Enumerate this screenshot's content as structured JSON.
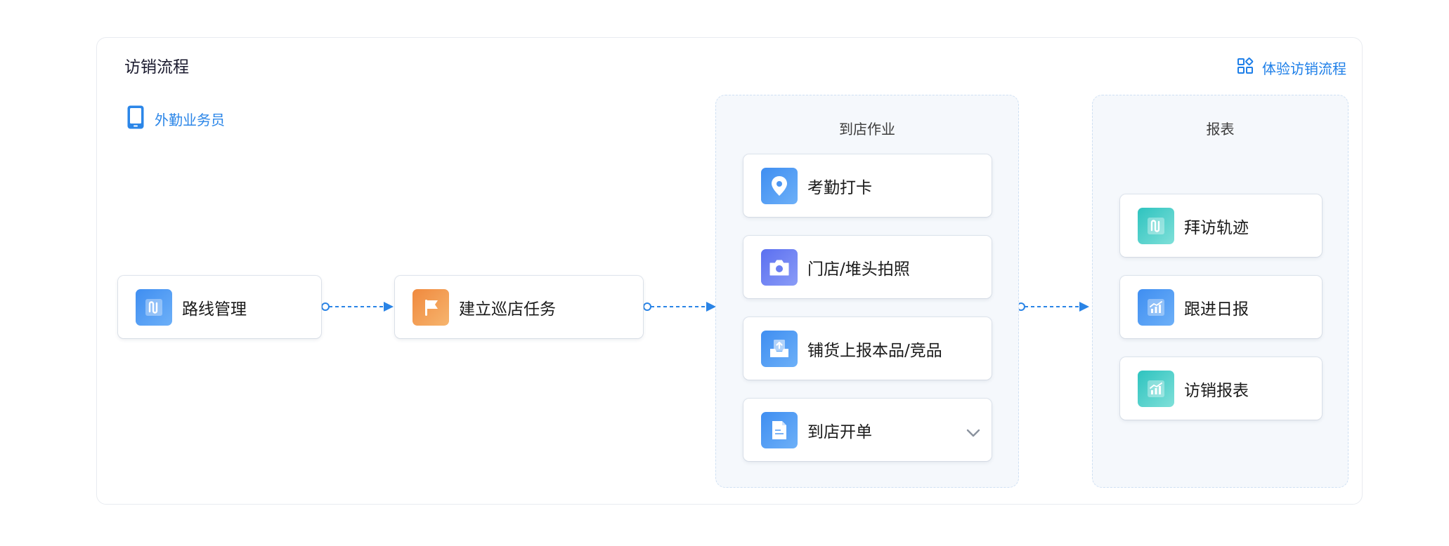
{
  "header": {
    "title": "访销流程",
    "experience_label": "体验访销流程"
  },
  "role": {
    "label": "外勤业务员",
    "icon": "phone-icon"
  },
  "flow": {
    "route": {
      "label": "路线管理",
      "icon": "route-icon"
    },
    "task": {
      "label": "建立巡店任务",
      "icon": "flag-icon"
    },
    "store_ops": {
      "title": "到店作业",
      "items": [
        {
          "label": "考勤打卡",
          "icon": "location-pin-icon"
        },
        {
          "label": "门店/堆头拍照",
          "icon": "camera-icon"
        },
        {
          "label": "铺货上报本品/竞品",
          "icon": "upload-tray-icon"
        },
        {
          "label": "到店开单",
          "icon": "receipt-icon"
        }
      ]
    },
    "reports": {
      "title": "报表",
      "items": [
        {
          "label": "拜访轨迹",
          "icon": "route-icon"
        },
        {
          "label": "跟进日报",
          "icon": "chart-icon"
        },
        {
          "label": "访销报表",
          "icon": "chart-icon"
        }
      ]
    }
  },
  "colors": {
    "accent": "#1e7fe8",
    "connector": "#2a84e6",
    "group_bg": "#f5f8fc"
  }
}
